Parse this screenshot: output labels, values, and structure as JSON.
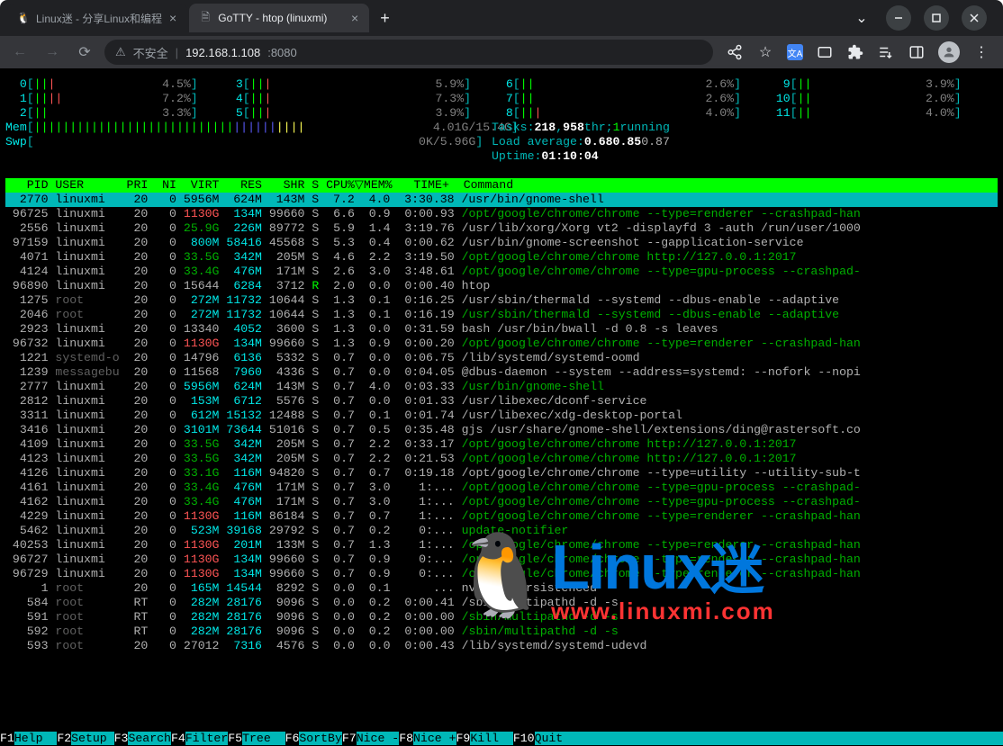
{
  "browser": {
    "tab1_title": "Linux迷 - 分享Linux和编程",
    "tab2_title": "GoTTY - htop (linuxmi)",
    "url_insecure_label": "不安全",
    "url_host": "192.168.1.108",
    "url_port": ":8080"
  },
  "cpu_meters": {
    "col1": [
      {
        "n": "0",
        "bars": "|||",
        "pct": "4.5%"
      },
      {
        "n": "1",
        "bars": "||||",
        "pct": "7.2%"
      },
      {
        "n": "2",
        "bars": "||",
        "pct": "3.3%"
      }
    ],
    "col2": [
      {
        "n": "3",
        "bars": "|||",
        "pct": "5.9%"
      },
      {
        "n": "4",
        "bars": "|||",
        "pct": "7.3%"
      },
      {
        "n": "5",
        "bars": "|||",
        "pct": "3.9%"
      }
    ],
    "col3": [
      {
        "n": "6",
        "bars": "||",
        "pct": "2.6%"
      },
      {
        "n": "7",
        "bars": "||",
        "pct": "2.6%"
      },
      {
        "n": "8",
        "bars": "|||",
        "pct": "4.0%"
      }
    ],
    "col4": [
      {
        "n": " 9",
        "bars": "||",
        "pct": "3.9%"
      },
      {
        "n": "10",
        "bars": "||",
        "pct": "2.0%"
      },
      {
        "n": "11",
        "bars": "||",
        "pct": "4.0%"
      }
    ]
  },
  "memory": {
    "label": "Mem",
    "bars": "||||||||||||||||||||||||||||||||||||||",
    "value": "4.01G/15.4G"
  },
  "swap": {
    "label": "Swp",
    "value": "0K/5.96G"
  },
  "tasks": {
    "label": "Tasks:",
    "a": "218",
    "b": "958",
    "thr": "thr;",
    "run_n": "1",
    "run": "running"
  },
  "load": {
    "label": "Load average:",
    "v1": "0.68",
    "v2": "0.85",
    "v3": "0.87"
  },
  "uptime": {
    "label": "Uptime:",
    "value": "01:10:04"
  },
  "header_cols": "   PID USER      PRI  NI  VIRT   RES   SHR S CPU%▽MEM%   TIME+  Command",
  "highlight_row": "  2770 linuxmi    20   0 5956M  624M  143M S  7.2  4.0  3:30.38 /usr/bin/gnome-shell",
  "rows": [
    {
      "pid": "96725",
      "user": "linuxmi",
      "pri": "20",
      "ni": "0",
      "virt": "1130G",
      "virt_c": "red",
      "res": "134M",
      "shr": "99660",
      "st": "S",
      "cpu": "6.6",
      "mem": "0.9",
      "time": "0:00.93",
      "cmd": "/opt/google/chrome/chrome --type=renderer --crashpad-han",
      "cmd_c": "dgreen"
    },
    {
      "pid": " 2556",
      "user": "linuxmi",
      "pri": "20",
      "ni": "0",
      "virt": "25.9G",
      "virt_c": "dgreen",
      "res": "226M",
      "shr": "89772",
      "st": "S",
      "cpu": "5.9",
      "mem": "1.4",
      "time": "3:19.76",
      "cmd": "/usr/lib/xorg/Xorg vt2 -displayfd 3 -auth /run/user/1000",
      "cmd_c": "dim"
    },
    {
      "pid": "97159",
      "user": "linuxmi",
      "pri": "20",
      "ni": "0",
      "virt": "800M",
      "virt_c": "cyan",
      "res": "58416",
      "shr": "45568",
      "st": "S",
      "cpu": "5.3",
      "mem": "0.4",
      "time": "0:00.62",
      "cmd": "/usr/bin/gnome-screenshot --gapplication-service",
      "cmd_c": "dim"
    },
    {
      "pid": " 4071",
      "user": "linuxmi",
      "pri": "20",
      "ni": "0",
      "virt": "33.5G",
      "virt_c": "dgreen",
      "res": "342M",
      "shr": "205M",
      "st": "S",
      "cpu": "4.6",
      "mem": "2.2",
      "time": "3:19.50",
      "cmd": "/opt/google/chrome/chrome http://127.0.0.1:2017",
      "cmd_c": "dgreen"
    },
    {
      "pid": " 4124",
      "user": "linuxmi",
      "pri": "20",
      "ni": "0",
      "virt": "33.4G",
      "virt_c": "dgreen",
      "res": "476M",
      "shr": "171M",
      "st": "S",
      "cpu": "2.6",
      "mem": "3.0",
      "time": "3:48.61",
      "cmd": "/opt/google/chrome/chrome --type=gpu-process --crashpad-",
      "cmd_c": "dgreen"
    },
    {
      "pid": "96890",
      "user": "linuxmi",
      "pri": "20",
      "ni": "0",
      "virt": "15644",
      "virt_c": "dim",
      "res": "6284",
      "shr": "3712",
      "st": "R",
      "st_c": "green",
      "cpu": "2.0",
      "mem": "0.0",
      "time": "0:00.40",
      "cmd": "htop",
      "cmd_c": "dim"
    },
    {
      "pid": " 1275",
      "user": "root",
      "user_c": "dgrey",
      "pri": "20",
      "ni": "0",
      "virt": "272M",
      "virt_c": "cyan",
      "res": "11732",
      "shr": "10644",
      "st": "S",
      "cpu": "1.3",
      "mem": "0.1",
      "time": "0:16.25",
      "cmd": "/usr/sbin/thermald --systemd --dbus-enable --adaptive",
      "cmd_c": "dim"
    },
    {
      "pid": " 2046",
      "user": "root",
      "user_c": "dgrey",
      "pri": "20",
      "ni": "0",
      "virt": "272M",
      "virt_c": "cyan",
      "res": "11732",
      "shr": "10644",
      "st": "S",
      "cpu": "1.3",
      "mem": "0.1",
      "time": "0:16.19",
      "cmd": "/usr/sbin/thermald --systemd --dbus-enable --adaptive",
      "cmd_c": "dgreen"
    },
    {
      "pid": " 2923",
      "user": "linuxmi",
      "pri": "20",
      "ni": "0",
      "virt": "13340",
      "virt_c": "dim",
      "res": "4052",
      "shr": "3600",
      "st": "S",
      "cpu": "1.3",
      "mem": "0.0",
      "time": "0:31.59",
      "cmd": "bash /usr/bin/bwall -d 0.8 -s leaves",
      "cmd_c": "dim"
    },
    {
      "pid": "96732",
      "user": "linuxmi",
      "pri": "20",
      "ni": "0",
      "virt": "1130G",
      "virt_c": "red",
      "res": "134M",
      "shr": "99660",
      "st": "S",
      "cpu": "1.3",
      "mem": "0.9",
      "time": "0:00.20",
      "cmd": "/opt/google/chrome/chrome --type=renderer --crashpad-han",
      "cmd_c": "dgreen"
    },
    {
      "pid": " 1221",
      "user": "systemd-o",
      "user_c": "dgrey",
      "pri": "20",
      "ni": "0",
      "virt": "14796",
      "virt_c": "dim",
      "res": "6136",
      "shr": "5332",
      "st": "S",
      "cpu": "0.7",
      "mem": "0.0",
      "time": "0:06.75",
      "cmd": "/lib/systemd/systemd-oomd",
      "cmd_c": "dim"
    },
    {
      "pid": " 1239",
      "user": "messagebu",
      "user_c": "dgrey",
      "pri": "20",
      "ni": "0",
      "virt": "11568",
      "virt_c": "dim",
      "res": "7960",
      "shr": "4336",
      "st": "S",
      "cpu": "0.7",
      "mem": "0.0",
      "time": "0:04.05",
      "cmd": "@dbus-daemon --system --address=systemd: --nofork --nopi",
      "cmd_c": "dim"
    },
    {
      "pid": " 2777",
      "user": "linuxmi",
      "pri": "20",
      "ni": "0",
      "virt": "5956M",
      "virt_c": "cyan",
      "res": "624M",
      "shr": "143M",
      "st": "S",
      "cpu": "0.7",
      "mem": "4.0",
      "time": "0:03.33",
      "cmd": "/usr/bin/gnome-shell",
      "cmd_c": "dgreen"
    },
    {
      "pid": " 2812",
      "user": "linuxmi",
      "pri": "20",
      "ni": "0",
      "virt": "153M",
      "virt_c": "cyan",
      "res": "6712",
      "shr": "5576",
      "st": "S",
      "cpu": "0.7",
      "mem": "0.0",
      "time": "0:01.33",
      "cmd": "/usr/libexec/dconf-service",
      "cmd_c": "dim"
    },
    {
      "pid": " 3311",
      "user": "linuxmi",
      "pri": "20",
      "ni": "0",
      "virt": "612M",
      "virt_c": "cyan",
      "res": "15132",
      "shr": "12488",
      "st": "S",
      "cpu": "0.7",
      "mem": "0.1",
      "time": "0:01.74",
      "cmd": "/usr/libexec/xdg-desktop-portal",
      "cmd_c": "dim"
    },
    {
      "pid": " 3416",
      "user": "linuxmi",
      "pri": "20",
      "ni": "0",
      "virt": "3101M",
      "virt_c": "cyan",
      "res": "73644",
      "shr": "51016",
      "st": "S",
      "cpu": "0.7",
      "mem": "0.5",
      "time": "0:35.48",
      "cmd": "gjs /usr/share/gnome-shell/extensions/ding@rastersoft.co",
      "cmd_c": "dim"
    },
    {
      "pid": " 4109",
      "user": "linuxmi",
      "pri": "20",
      "ni": "0",
      "virt": "33.5G",
      "virt_c": "dgreen",
      "res": "342M",
      "shr": "205M",
      "st": "S",
      "cpu": "0.7",
      "mem": "2.2",
      "time": "0:33.17",
      "cmd": "/opt/google/chrome/chrome http://127.0.0.1:2017",
      "cmd_c": "dgreen"
    },
    {
      "pid": " 4123",
      "user": "linuxmi",
      "pri": "20",
      "ni": "0",
      "virt": "33.5G",
      "virt_c": "dgreen",
      "res": "342M",
      "shr": "205M",
      "st": "S",
      "cpu": "0.7",
      "mem": "2.2",
      "time": "0:21.53",
      "cmd": "/opt/google/chrome/chrome http://127.0.0.1:2017",
      "cmd_c": "dgreen"
    },
    {
      "pid": " 4126",
      "user": "linuxmi",
      "pri": "20",
      "ni": "0",
      "virt": "33.1G",
      "virt_c": "dgreen",
      "res": "116M",
      "shr": "94820",
      "st": "S",
      "cpu": "0.7",
      "mem": "0.7",
      "time": "0:19.18",
      "cmd": "/opt/google/chrome/chrome --type=utility --utility-sub-t",
      "cmd_c": "dim"
    },
    {
      "pid": " 4161",
      "user": "linuxmi",
      "pri": "20",
      "ni": "0",
      "virt": "33.4G",
      "virt_c": "dgreen",
      "res": "476M",
      "shr": "171M",
      "st": "S",
      "cpu": "0.7",
      "mem": "3.0",
      "time": "1:...",
      "cmd": "/opt/google/chrome/chrome --type=gpu-process --crashpad-",
      "cmd_c": "dgreen"
    },
    {
      "pid": " 4162",
      "user": "linuxmi",
      "pri": "20",
      "ni": "0",
      "virt": "33.4G",
      "virt_c": "dgreen",
      "res": "476M",
      "shr": "171M",
      "st": "S",
      "cpu": "0.7",
      "mem": "3.0",
      "time": "1:...",
      "cmd": "/opt/google/chrome/chrome --type=gpu-process --crashpad-",
      "cmd_c": "dgreen"
    },
    {
      "pid": " 4229",
      "user": "linuxmi",
      "pri": "20",
      "ni": "0",
      "virt": "1130G",
      "virt_c": "red",
      "res": "116M",
      "shr": "86184",
      "st": "S",
      "cpu": "0.7",
      "mem": "0.7",
      "time": "1:...",
      "cmd": "/opt/google/chrome/chrome --type=renderer --crashpad-han",
      "cmd_c": "dgreen"
    },
    {
      "pid": " 5462",
      "user": "linuxmi",
      "pri": "20",
      "ni": "0",
      "virt": "523M",
      "virt_c": "cyan",
      "res": "39168",
      "shr": "29792",
      "st": "S",
      "cpu": "0.7",
      "mem": "0.2",
      "time": "0:...",
      "cmd": "update-notifier",
      "cmd_c": "dgreen"
    },
    {
      "pid": "40253",
      "user": "linuxmi",
      "pri": "20",
      "ni": "0",
      "virt": "1130G",
      "virt_c": "red",
      "res": "201M",
      "shr": "133M",
      "st": "S",
      "cpu": "0.7",
      "mem": "1.3",
      "time": "1:...",
      "cmd": "/opt/google/chrome/chrome --type=renderer --crashpad-han",
      "cmd_c": "dgreen"
    },
    {
      "pid": "96727",
      "user": "linuxmi",
      "pri": "20",
      "ni": "0",
      "virt": "1130G",
      "virt_c": "red",
      "res": "134M",
      "shr": "99660",
      "st": "S",
      "cpu": "0.7",
      "mem": "0.9",
      "time": "0:...",
      "cmd": "/opt/google/chrome/chrome --type=renderer --crashpad-han",
      "cmd_c": "dgreen"
    },
    {
      "pid": "96729",
      "user": "linuxmi",
      "pri": "20",
      "ni": "0",
      "virt": "1130G",
      "virt_c": "red",
      "res": "134M",
      "shr": "99660",
      "st": "S",
      "cpu": "0.7",
      "mem": "0.9",
      "time": "0:...",
      "cmd": "/opt/google/chrome/chrome --type=renderer --crashpad-han",
      "cmd_c": "dgreen"
    },
    {
      "pid": "    1",
      "user": "root",
      "user_c": "dgrey",
      "pri": "20",
      "ni": "0",
      "virt": "165M",
      "virt_c": "cyan",
      "res": "14544",
      "shr": "8292",
      "st": "S",
      "cpu": "0.0",
      "mem": "0.1",
      "time": "...",
      "cmd": "nvidia-persistenced",
      "cmd_c": "dim"
    },
    {
      "pid": "  584",
      "user": "root",
      "user_c": "dgrey",
      "pri": "RT",
      "ni": "0",
      "virt": "282M",
      "virt_c": "cyan",
      "res": "28176",
      "shr": "9096",
      "st": "S",
      "cpu": "0.0",
      "mem": "0.2",
      "time": "0:00.41",
      "cmd": "/sbin/multipathd -d -s",
      "cmd_c": "dim"
    },
    {
      "pid": "  591",
      "user": "root",
      "user_c": "dgrey",
      "pri": "RT",
      "ni": "0",
      "virt": "282M",
      "virt_c": "cyan",
      "res": "28176",
      "shr": "9096",
      "st": "S",
      "cpu": "0.0",
      "mem": "0.2",
      "time": "0:00.00",
      "cmd": "/sbin/multipathd -d -s",
      "cmd_c": "dgreen"
    },
    {
      "pid": "  592",
      "user": "root",
      "user_c": "dgrey",
      "pri": "RT",
      "ni": "0",
      "virt": "282M",
      "virt_c": "cyan",
      "res": "28176",
      "shr": "9096",
      "st": "S",
      "cpu": "0.0",
      "mem": "0.2",
      "time": "0:00.00",
      "cmd": "/sbin/multipathd -d -s",
      "cmd_c": "dgreen"
    },
    {
      "pid": "  593",
      "user": "root",
      "user_c": "dgrey",
      "pri": "20",
      "ni": "0",
      "virt": "27012",
      "virt_c": "dim",
      "res": "7316",
      "shr": "4576",
      "st": "S",
      "cpu": "0.0",
      "mem": "0.0",
      "time": "0:00.43",
      "cmd": "/lib/systemd/systemd-udevd",
      "cmd_c": "dim"
    }
  ],
  "fkeys": [
    {
      "k": "F1",
      "l": "Help"
    },
    {
      "k": "F2",
      "l": "Setup"
    },
    {
      "k": "F3",
      "l": "Search"
    },
    {
      "k": "F4",
      "l": "Filter"
    },
    {
      "k": "F5",
      "l": "Tree"
    },
    {
      "k": "F6",
      "l": "SortBy"
    },
    {
      "k": "F7",
      "l": "Nice -"
    },
    {
      "k": "F8",
      "l": "Nice +"
    },
    {
      "k": "F9",
      "l": "Kill"
    },
    {
      "k": "F10",
      "l": "Quit"
    }
  ],
  "watermark": {
    "brand": "Linux",
    "brand2": "迷",
    "url": "www.linuxmi.com"
  }
}
